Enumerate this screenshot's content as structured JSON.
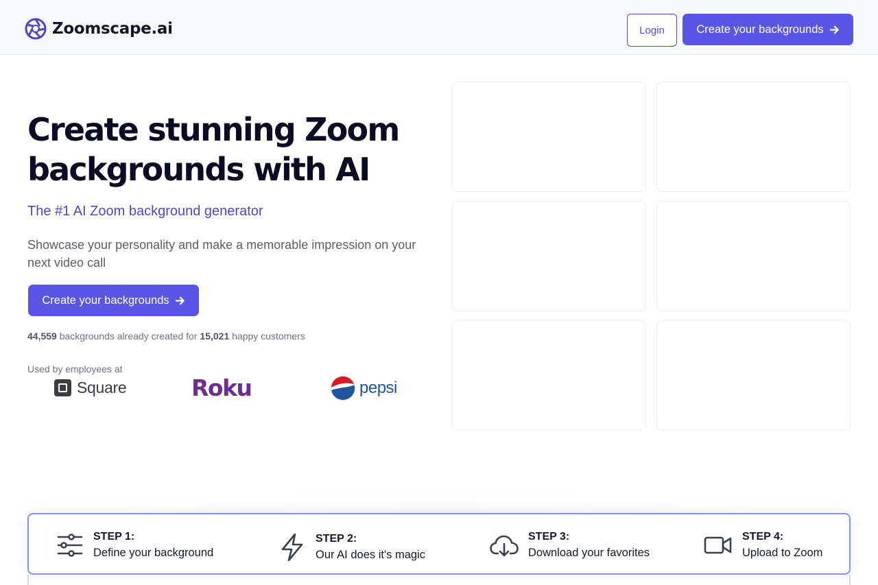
{
  "header": {
    "brand_name": "Zoomscape.ai",
    "login_label": "Login",
    "cta_label": "Create your backgrounds"
  },
  "hero": {
    "title_line1": "Create stunning Zoom",
    "title_line2": "backgrounds with AI",
    "subtitle": "The #1 AI Zoom background generator",
    "description": "Showcase your personality and make a memorable impression on your next video call",
    "cta_label": "Create your backgrounds",
    "stats": {
      "backgrounds_count": "44,559",
      "backgrounds_text": "backgrounds already created for",
      "customers_count": "15,021",
      "customers_text": "happy customers"
    },
    "used_by_label": "Used by employees at",
    "logos": [
      "Square",
      "Roku",
      "pepsi"
    ]
  },
  "gallery": {
    "cards": 6
  },
  "steps": [
    {
      "label": "STEP 1:",
      "text": "Define your background",
      "icon": "sliders-icon"
    },
    {
      "label": "STEP 2:",
      "text": "Our AI does it's magic",
      "icon": "lightning-icon"
    },
    {
      "label": "STEP 3:",
      "text": "Download your favorites",
      "icon": "cloud-download-icon"
    },
    {
      "label": "STEP 4:",
      "text": "Upload to Zoom",
      "icon": "video-camera-icon"
    }
  ],
  "colors": {
    "brand": "#5b55e6",
    "subtitle": "#4f46c5",
    "steps_border": "#8b8cf0"
  }
}
